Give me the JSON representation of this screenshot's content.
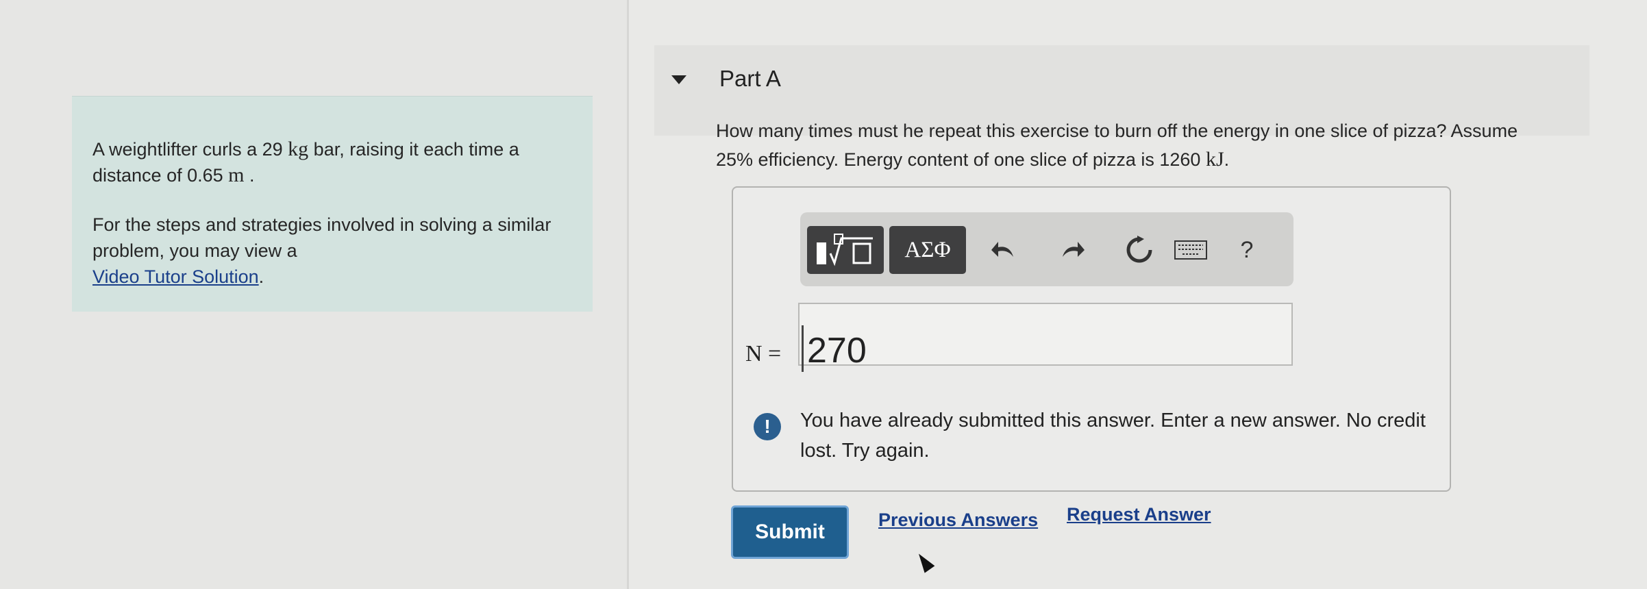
{
  "problem": {
    "text_part1": "A weightlifter curls a 29",
    "mass_unit": "kg",
    "text_part2": "bar, raising it each time a distance of 0.65",
    "distance_unit": "m",
    "text_part3": ".",
    "hint_text": "For the steps and strategies involved in solving a similar problem, you may view a",
    "hint_link": "Video Tutor Solution",
    "hint_end": "."
  },
  "part": {
    "title": "Part A",
    "question_part1": "How many times must he repeat this exercise to burn off the energy in one slice of pizza? Assume 25% efficiency. Energy content of one slice of pizza is 1260",
    "question_unit": "kJ",
    "question_end": "."
  },
  "toolbar": {
    "symbols_label": "ΑΣΦ",
    "help_label": "?",
    "icons": [
      "templates-icon",
      "undo-icon",
      "redo-icon",
      "reset-icon",
      "keyboard-icon",
      "help-icon"
    ]
  },
  "answer": {
    "variable_label": "N =",
    "value": "270"
  },
  "feedback": {
    "message": "You have already submitted this answer. Enter a new answer. No credit lost. Try again."
  },
  "actions": {
    "submit_label": "Submit",
    "previous_answers_label": "Previous Answers",
    "request_answer_label": "Request Answer"
  }
}
